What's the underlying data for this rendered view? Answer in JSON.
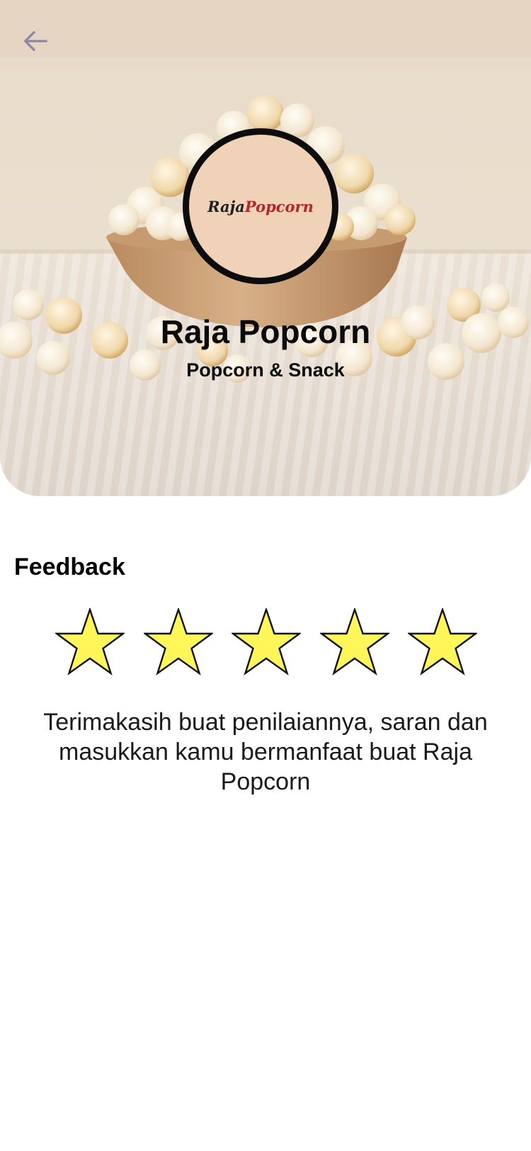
{
  "header": {
    "back_icon": "arrow-left-icon"
  },
  "hero": {
    "logo": {
      "part1": "Raja",
      "part2": "Popcorn"
    },
    "name": "Raja Popcorn",
    "category": "Popcorn & Snack"
  },
  "feedback": {
    "title": "Feedback",
    "rating": 5,
    "max_rating": 5,
    "star_icon": "star-icon",
    "star_color": "#FFF75A",
    "message": "Terimakasih buat penilaiannya, saran dan masukkan kamu bermanfaat buat Raja Popcorn"
  },
  "colors": {
    "logo_background": "#EFD2B7",
    "logo_accent": "#B3272A",
    "back_icon": "#8A87A8"
  }
}
